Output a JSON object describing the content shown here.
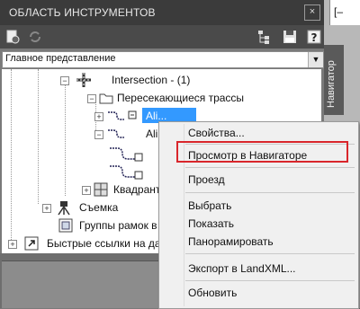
{
  "titlebar": {
    "title": "ОБЛАСТЬ ИНСТРУМЕНТОВ",
    "close": "×"
  },
  "doc_tab": {
    "label": "[–"
  },
  "side_tab": {
    "label": "Навигатор"
  },
  "view_select": {
    "value": "Главное представление",
    "arrow": "▼"
  },
  "tree": {
    "intersection": "Intersection - (1)",
    "crossing_routes": "Пересекающиеся трассы",
    "alignment_1": "Ali...",
    "alignment_2": "Ali...",
    "quadrants": "Квадранты",
    "survey": "Съемка",
    "frame_groups": "Группы рамок в",
    "quick_links": "Быстрые ссылки на дан",
    "expand_minus": "−",
    "expand_plus": "+"
  },
  "context_menu": {
    "properties": "Свойства...",
    "view_in_navigator": "Просмотр в Навигаторе",
    "flythrough": "Проезд",
    "select": "Выбрать",
    "show": "Показать",
    "pan": "Панорамировать",
    "export_landxml": "Экспорт в LandXML...",
    "refresh": "Обновить"
  },
  "colors": {
    "highlight_border": "#d9262b",
    "selection": "#3399ff",
    "titlebar": "#3b3b3b"
  }
}
